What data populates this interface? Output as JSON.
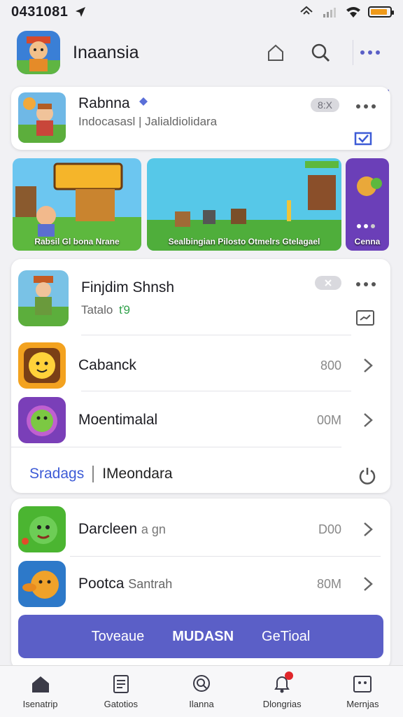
{
  "status": {
    "time": "0431081"
  },
  "header": {
    "title": "Inaansia"
  },
  "featured": {
    "name": "Rabnna",
    "subtitle": "Indocasasl | Jalialdiolidara",
    "pill": "8:X"
  },
  "banners": [
    {
      "caption": "Rabsil Gl bona Nrane"
    },
    {
      "caption": "Sealbingian Pilosto Otmelrs Gtelagael"
    },
    {
      "caption": "Cenna"
    }
  ],
  "list_card": {
    "header": {
      "name": "Finjdim Shnsh",
      "sub": "Tatalo",
      "sub_badge": "ť9"
    },
    "items": [
      {
        "label": "Cabanck",
        "size": "800"
      },
      {
        "label": "Moentimalal",
        "size": "00M"
      }
    ],
    "tabs": {
      "left": "Sradags",
      "right": "IMeondara"
    }
  },
  "list_card2": {
    "items": [
      {
        "label": "Darcleen",
        "extra": "a gn",
        "size": "D00"
      },
      {
        "label": "Pootca",
        "extra": "Santrah",
        "size": "80M"
      }
    ],
    "cta": {
      "left": "Toveaue",
      "mid": "MUDASN",
      "right": "GeTioal"
    }
  },
  "bottom_nav": [
    {
      "label": "Isenatrip",
      "icon": "home-icon"
    },
    {
      "label": "Gatotios",
      "icon": "document-icon"
    },
    {
      "label": "Ilanna",
      "icon": "search-icon"
    },
    {
      "label": "Dlongrias",
      "icon": "notification-icon"
    },
    {
      "label": "Mernjas",
      "icon": "profile-icon"
    }
  ]
}
